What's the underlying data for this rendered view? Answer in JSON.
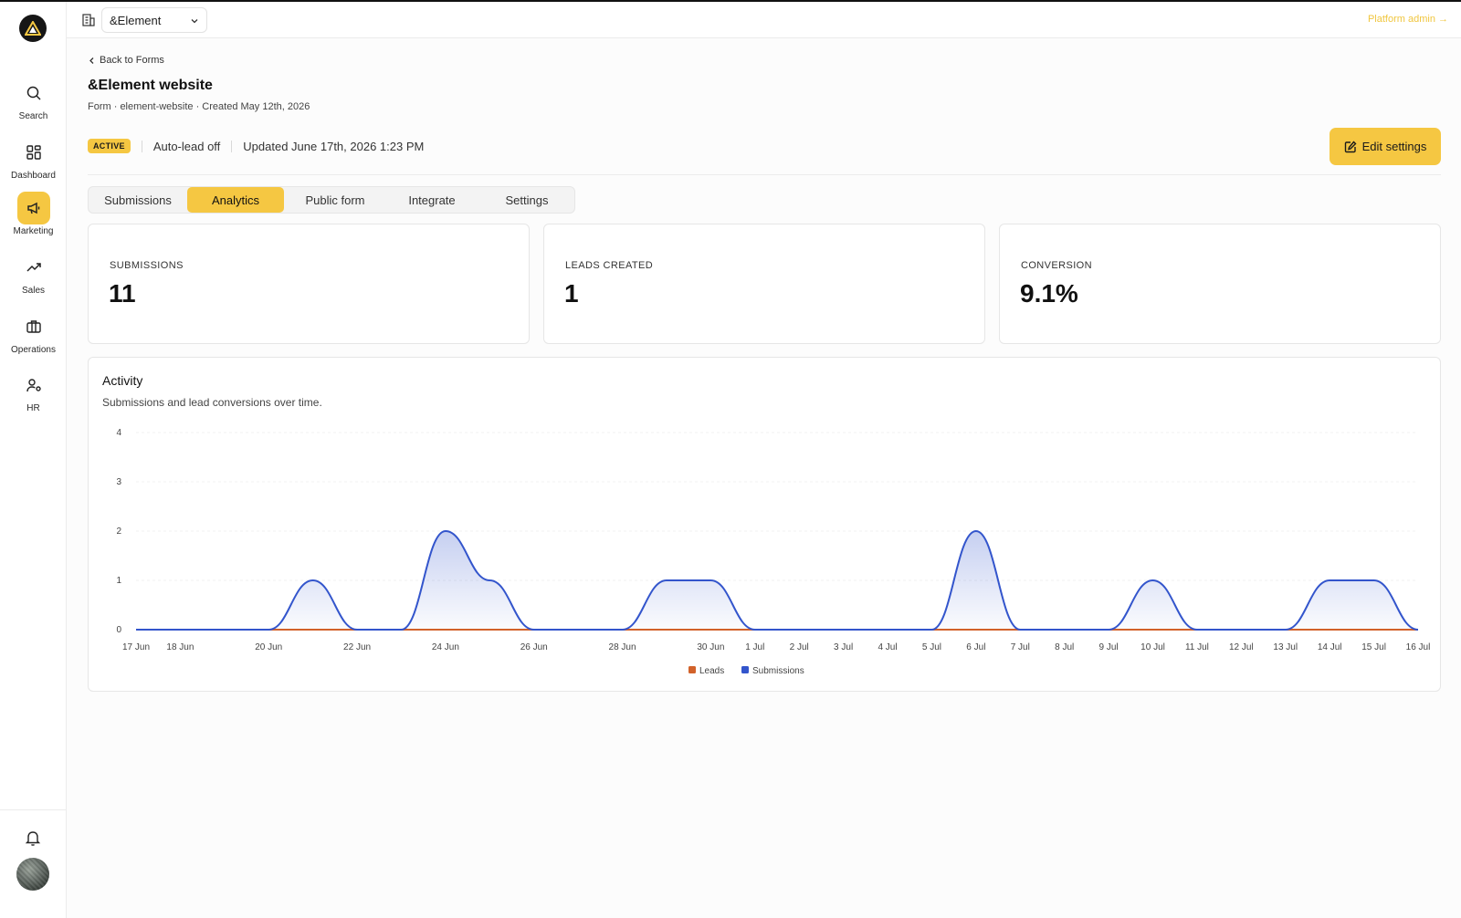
{
  "sidebar": {
    "items": [
      {
        "label": "Search",
        "icon": "search-icon"
      },
      {
        "label": "Dashboard",
        "icon": "grid-icon"
      },
      {
        "label": "Marketing",
        "icon": "megaphone-icon",
        "active": true
      },
      {
        "label": "Sales",
        "icon": "trending-up-icon"
      },
      {
        "label": "Operations",
        "icon": "briefcase-icon"
      },
      {
        "label": "HR",
        "icon": "user-settings-icon"
      }
    ]
  },
  "topbar": {
    "org_name": "&Element",
    "platform_admin": "Platform admin →"
  },
  "header": {
    "back_label": "Back to Forms",
    "title": "&Element website",
    "meta": "Form · element-website · Created May 12th, 2026",
    "status_badge": "ACTIVE",
    "auto_lead": "Auto-lead off",
    "updated": "Updated June 17th, 2026 1:23 PM",
    "edit_button": "Edit settings"
  },
  "tabs": [
    "Submissions",
    "Analytics",
    "Public form",
    "Integrate",
    "Settings"
  ],
  "active_tab": "Analytics",
  "kpis": [
    {
      "label": "SUBMISSIONS",
      "value": "11"
    },
    {
      "label": "LEADS CREATED",
      "value": "1"
    },
    {
      "label": "CONVERSION",
      "value": "9.1%"
    }
  ],
  "activity": {
    "title": "Activity",
    "subtitle": "Submissions and lead conversions over time."
  },
  "colors": {
    "accent": "#f5c742",
    "submissions": "#3355cc",
    "leads": "#d2622a"
  },
  "chart_data": {
    "type": "area",
    "x": [
      "17 Jun",
      "18 Jun",
      "19 Jun",
      "20 Jun",
      "21 Jun",
      "22 Jun",
      "23 Jun",
      "24 Jun",
      "25 Jun",
      "26 Jun",
      "27 Jun",
      "28 Jun",
      "29 Jun",
      "30 Jun",
      "1 Jul",
      "2 Jul",
      "3 Jul",
      "4 Jul",
      "5 Jul",
      "6 Jul",
      "7 Jul",
      "8 Jul",
      "9 Jul",
      "10 Jul",
      "11 Jul",
      "12 Jul",
      "13 Jul",
      "14 Jul",
      "15 Jul",
      "16 Jul"
    ],
    "tick_labels": [
      "17 Jun",
      "18 Jun",
      "20 Jun",
      "22 Jun",
      "24 Jun",
      "26 Jun",
      "28 Jun",
      "30 Jun",
      "1 Jul",
      "2 Jul",
      "3 Jul",
      "4 Jul",
      "5 Jul",
      "6 Jul",
      "7 Jul",
      "8 Jul",
      "9 Jul",
      "10 Jul",
      "11 Jul",
      "12 Jul",
      "13 Jul",
      "14 Jul",
      "15 Jul",
      "16 Jul"
    ],
    "series": [
      {
        "name": "Leads",
        "values": [
          0,
          0,
          0,
          0,
          0,
          0,
          0,
          0,
          0,
          0,
          0,
          0,
          0,
          0,
          0,
          0,
          0,
          0,
          0,
          0,
          0,
          0,
          0,
          0,
          0,
          0,
          0,
          0,
          0,
          0
        ]
      },
      {
        "name": "Submissions",
        "values": [
          0,
          0,
          0,
          0,
          1,
          0,
          0,
          2,
          1,
          0,
          0,
          0,
          1,
          1,
          0,
          0,
          0,
          0,
          0,
          2,
          0,
          0,
          0,
          1,
          0,
          0,
          0,
          1,
          1,
          0
        ]
      }
    ],
    "yticks": [
      0,
      1,
      2,
      3,
      4
    ],
    "ylim": [
      0,
      4
    ],
    "legend": "bottom-center"
  }
}
